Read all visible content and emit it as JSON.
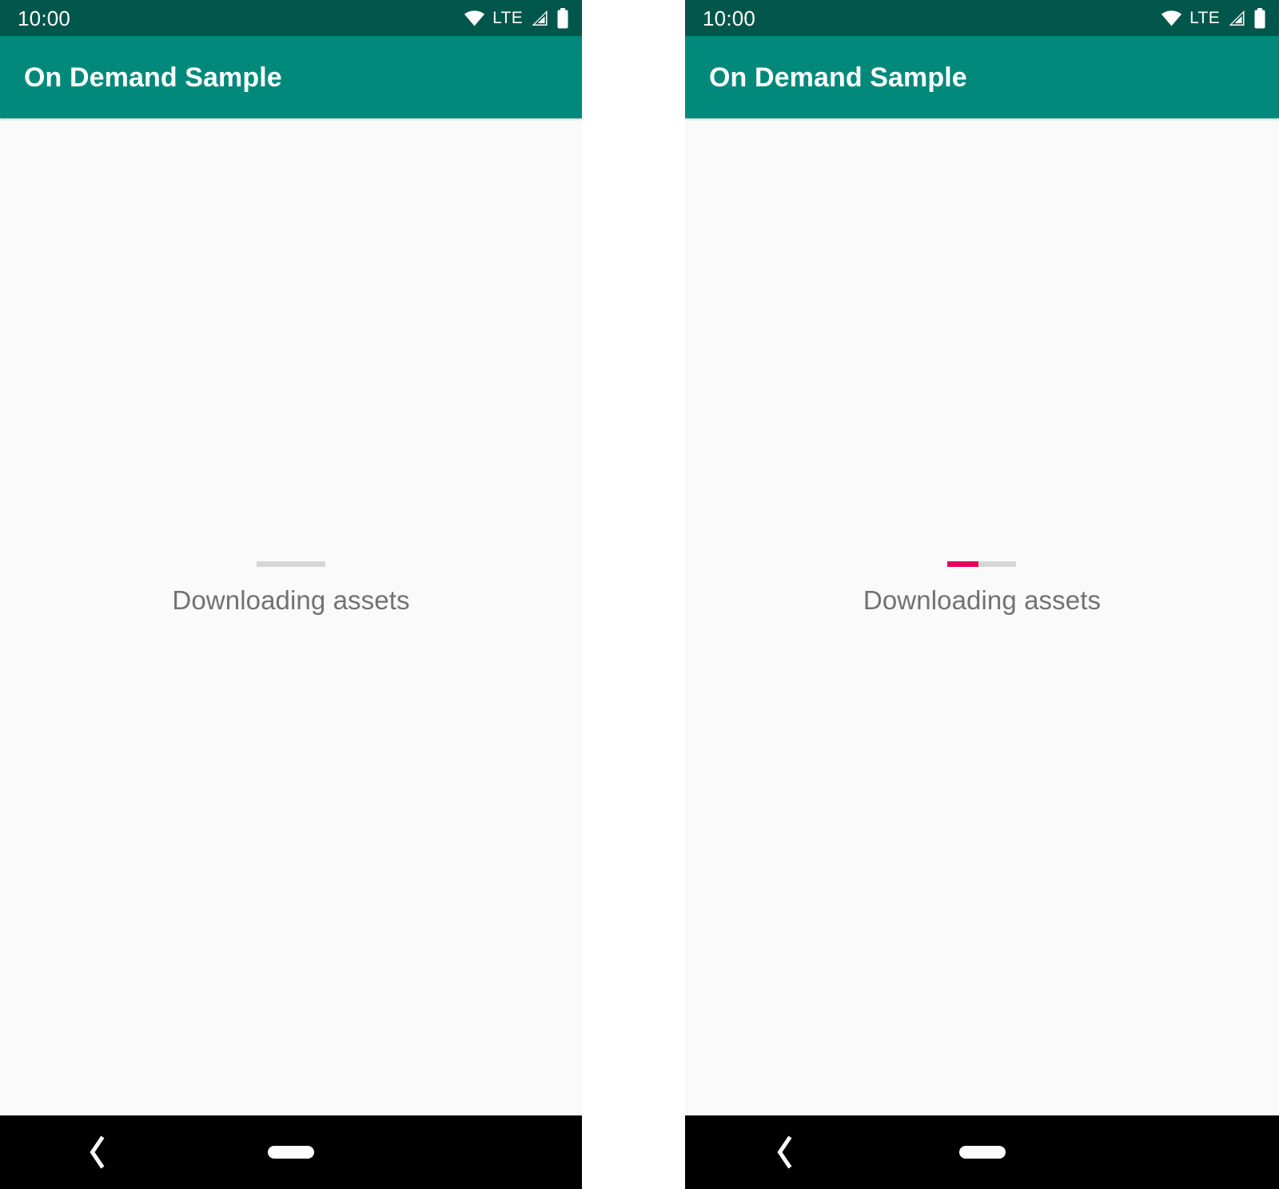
{
  "panels": [
    {
      "id": "left",
      "status_bar": {
        "clock": "10:00",
        "icons": [
          "wifi-icon",
          "lte-label",
          "cellular-signal-icon",
          "battery-icon"
        ],
        "lte_label": "LTE",
        "background": "#00564a"
      },
      "app_bar": {
        "title": "On Demand Sample",
        "background": "#00897b",
        "text_color": "#ffffff"
      },
      "main": {
        "progress": {
          "name": "download-progress-bar",
          "percent": 0,
          "determinate": false,
          "track_color": "#d6d6d6",
          "fill_color": "#e8005a"
        },
        "status_text": "Downloading assets",
        "status_text_color": "#727272",
        "background": "#fafafa"
      },
      "nav_bar": {
        "background": "#000000",
        "back_label": "Back",
        "home_label": "Home"
      }
    },
    {
      "id": "right",
      "status_bar": {
        "clock": "10:00",
        "icons": [
          "wifi-icon",
          "lte-label",
          "cellular-signal-icon",
          "battery-icon"
        ],
        "lte_label": "LTE",
        "background": "#00564a"
      },
      "app_bar": {
        "title": "On Demand Sample",
        "background": "#00897b",
        "text_color": "#ffffff"
      },
      "main": {
        "progress": {
          "name": "download-progress-bar",
          "percent": 45,
          "determinate": true,
          "track_color": "#d6d6d6",
          "fill_color": "#e8005a"
        },
        "status_text": "Downloading assets",
        "status_text_color": "#727272",
        "background": "#fafafa"
      },
      "nav_bar": {
        "background": "#000000",
        "back_label": "Back",
        "home_label": "Home"
      }
    }
  ]
}
